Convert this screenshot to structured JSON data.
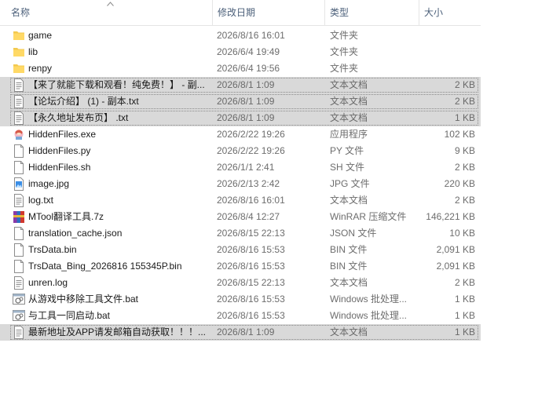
{
  "columns": {
    "name": "名称",
    "date": "修改日期",
    "type": "类型",
    "size": "大小"
  },
  "files": [
    {
      "name": "game",
      "date": "2026/8/16 16:01",
      "type": "文件夹",
      "size": "",
      "icon": "folder-icon",
      "selected": false
    },
    {
      "name": "lib",
      "date": "2026/6/4 19:49",
      "type": "文件夹",
      "size": "",
      "icon": "folder-icon",
      "selected": false
    },
    {
      "name": "renpy",
      "date": "2026/6/4 19:56",
      "type": "文件夹",
      "size": "",
      "icon": "folder-icon",
      "selected": false
    },
    {
      "name": "【来了就能下载和观看！纯免费！】 - 副...",
      "date": "2026/8/1 1:09",
      "type": "文本文档",
      "size": "2 KB",
      "icon": "text-file-icon",
      "selected": true
    },
    {
      "name": "【论坛介绍】 (1) - 副本.txt",
      "date": "2026/8/1 1:09",
      "type": "文本文档",
      "size": "2 KB",
      "icon": "text-file-icon",
      "selected": true
    },
    {
      "name": "【永久地址发布页】 .txt",
      "date": "2026/8/1 1:09",
      "type": "文本文档",
      "size": "1 KB",
      "icon": "text-file-icon",
      "selected": true
    },
    {
      "name": "HiddenFiles.exe",
      "date": "2026/2/22 19:26",
      "type": "应用程序",
      "size": "102 KB",
      "icon": "app-exe-icon",
      "selected": false
    },
    {
      "name": "HiddenFiles.py",
      "date": "2026/2/22 19:26",
      "type": "PY 文件",
      "size": "9 KB",
      "icon": "blank-file-icon",
      "selected": false
    },
    {
      "name": "HiddenFiles.sh",
      "date": "2026/1/1 2:41",
      "type": "SH 文件",
      "size": "2 KB",
      "icon": "blank-file-icon",
      "selected": false
    },
    {
      "name": "image.jpg",
      "date": "2026/2/13 2:42",
      "type": "JPG 文件",
      "size": "220 KB",
      "icon": "image-file-icon",
      "selected": false
    },
    {
      "name": "log.txt",
      "date": "2026/8/16 16:01",
      "type": "文本文档",
      "size": "2 KB",
      "icon": "text-file-icon",
      "selected": false
    },
    {
      "name": "MTool翻译工具.7z",
      "date": "2026/8/4 12:27",
      "type": "WinRAR 压缩文件",
      "size": "146,221 KB",
      "icon": "winrar-archive-icon",
      "selected": false
    },
    {
      "name": "translation_cache.json",
      "date": "2026/8/15 22:13",
      "type": "JSON 文件",
      "size": "10 KB",
      "icon": "blank-file-icon",
      "selected": false
    },
    {
      "name": "TrsData.bin",
      "date": "2026/8/16 15:53",
      "type": "BIN 文件",
      "size": "2,091 KB",
      "icon": "blank-file-icon",
      "selected": false
    },
    {
      "name": "TrsData_Bing_2026816 155345P.bin",
      "date": "2026/8/16 15:53",
      "type": "BIN 文件",
      "size": "2,091 KB",
      "icon": "blank-file-icon",
      "selected": false
    },
    {
      "name": "unren.log",
      "date": "2026/8/15 22:13",
      "type": "文本文档",
      "size": "2 KB",
      "icon": "text-file-icon",
      "selected": false
    },
    {
      "name": "从游戏中移除工具文件.bat",
      "date": "2026/8/16 15:53",
      "type": "Windows 批处理...",
      "size": "1 KB",
      "icon": "batch-file-icon",
      "selected": false
    },
    {
      "name": "与工具一同启动.bat",
      "date": "2026/8/16 15:53",
      "type": "Windows 批处理...",
      "size": "1 KB",
      "icon": "batch-file-icon",
      "selected": false
    },
    {
      "name": "最新地址及APP请发邮箱自动获取！！！...",
      "date": "2026/8/1 1:09",
      "type": "文本文档",
      "size": "1 KB",
      "icon": "text-file-icon",
      "selected": true
    }
  ]
}
